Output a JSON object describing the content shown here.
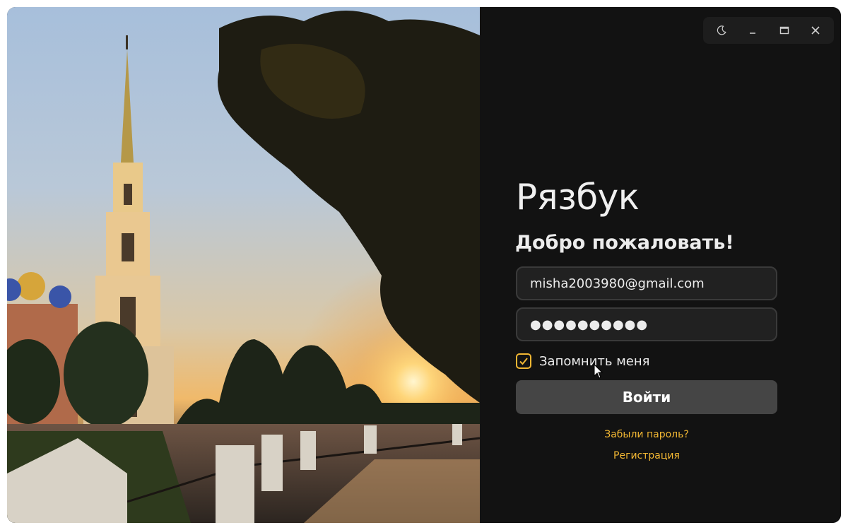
{
  "app": {
    "title": "Рязбук",
    "welcome": "Добро пожаловать!"
  },
  "titlebar": {
    "theme_icon": "moon-icon",
    "minimize_icon": "minimize-icon",
    "maximize_icon": "maximize-icon",
    "close_icon": "close-icon"
  },
  "form": {
    "email_value": "misha2003980@gmail.com",
    "password_value": "●●●●●●●●●●",
    "remember_label": "Запомнить меня",
    "remember_checked": true,
    "login_label": "Войти",
    "forgot_label": "Забыли пароль?",
    "register_label": "Регистрация"
  },
  "colors": {
    "accent": "#f2b733",
    "background": "#121212",
    "button": "#454545",
    "field_bg": "#212121"
  }
}
